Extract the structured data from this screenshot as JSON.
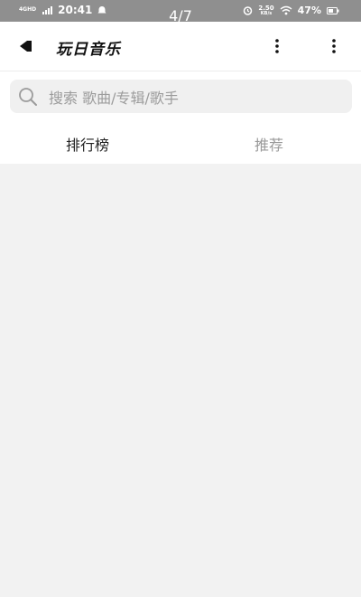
{
  "status_bar": {
    "network_label": "4G",
    "network_sub": "HD",
    "time": "20:41",
    "pager": "4/7",
    "speed_value": "2.50",
    "speed_unit": "KB/s",
    "battery": "47%"
  },
  "header": {
    "title": "玩日音乐"
  },
  "search": {
    "placeholder": "搜索 歌曲/专辑/歌手"
  },
  "tabs": [
    {
      "label": "排行榜",
      "active": true
    },
    {
      "label": "推荐",
      "active": false
    }
  ],
  "colors": {
    "status_bar_bg": "#8f8f8f",
    "page_bg": "#f2f2f2",
    "search_bg": "#f0f0f0",
    "active_tab": "#222222",
    "inactive_tab": "#9a9a9a"
  }
}
